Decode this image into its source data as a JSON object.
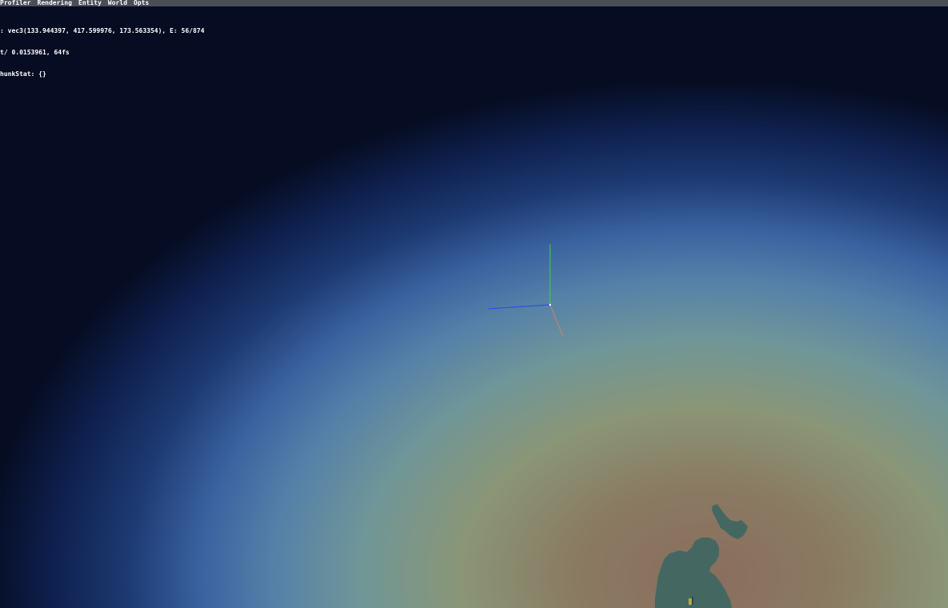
{
  "menubar": {
    "items": [
      {
        "label": "Profiler"
      },
      {
        "label": "Rendering"
      },
      {
        "label": "Entity"
      },
      {
        "label": "World"
      },
      {
        "label": "Opts"
      }
    ]
  },
  "debug": {
    "line1": ": vec3(133.944397, 417.599976, 173.563354), E: 56/874",
    "line2": "t/ 0.0153961, 64fs",
    "line3": "hunkStat: {}"
  },
  "colors": {
    "gizmo_x": "#d08070",
    "gizmo_y": "#3cd23c",
    "gizmo_z": "#3050e0",
    "terrain": "#3f6663"
  },
  "icons": {
    "gizmo": "axis-gizmo-icon"
  }
}
